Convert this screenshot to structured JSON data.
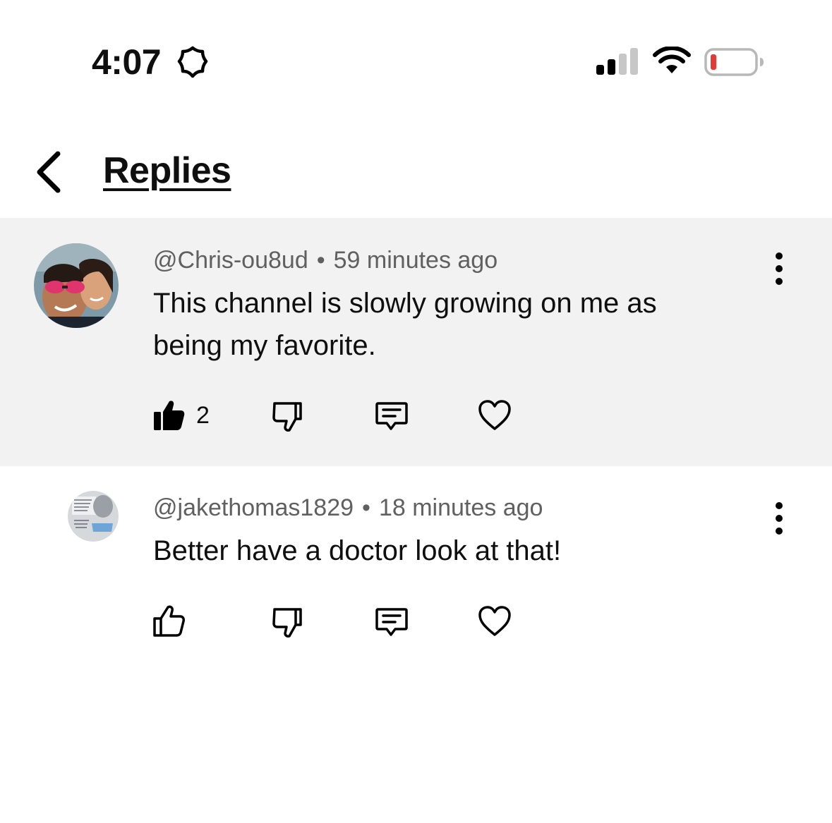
{
  "status_bar": {
    "time": "4:07",
    "icons": [
      "focus-icon",
      "cellular-signal-icon",
      "wifi-icon",
      "battery-low-icon"
    ],
    "battery_color": "#e53935"
  },
  "header": {
    "title": "Replies",
    "back_icon": "chevron-left-icon"
  },
  "comments": [
    {
      "author": "@Chris-ou8ud",
      "separator": "•",
      "time": "59 minutes ago",
      "text": "This channel is slowly growing on me as being my favorite.",
      "like_count": "2",
      "liked": true,
      "highlighted": true
    },
    {
      "author": "@jakethomas1829",
      "separator": "•",
      "time": "18 minutes ago",
      "text": "Better have a doctor look at that!",
      "like_count": "",
      "liked": false,
      "highlighted": false
    }
  ],
  "colors": {
    "highlight_bg": "#f2f2f2",
    "meta_text": "#606060",
    "primary_text": "#0f0f0f"
  }
}
